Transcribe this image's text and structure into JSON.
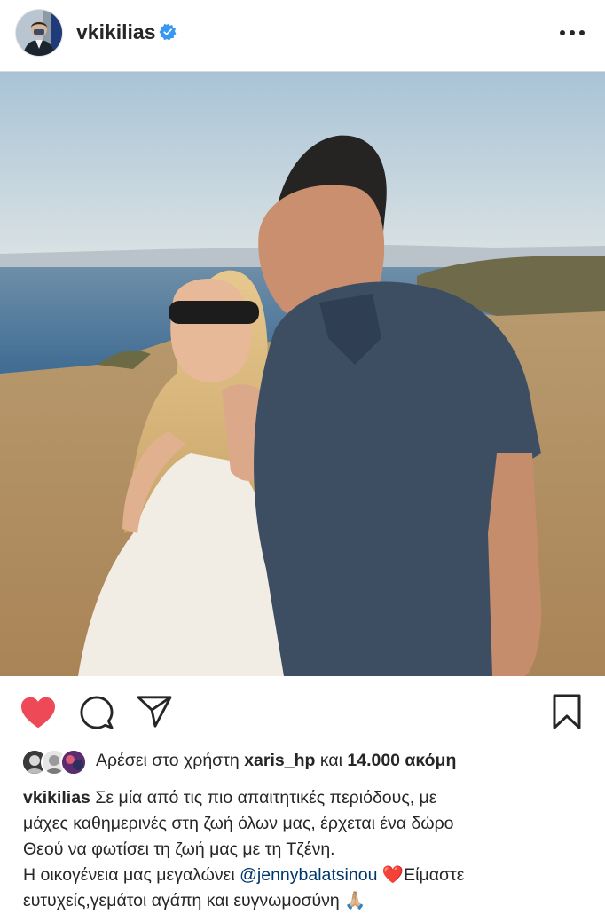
{
  "post": {
    "username": "vkikilias",
    "verified": true
  },
  "actions": {
    "liked": true,
    "like_color": "#ed4956",
    "icons": [
      "heart-icon",
      "comment-icon",
      "share-icon",
      "bookmark-icon"
    ]
  },
  "likes": {
    "prefix": "Αρέσει στο χρήστη",
    "user": "xaris_hp",
    "middle": "και",
    "count": "14.000 ακόμη"
  },
  "caption": {
    "username": "vkikilias",
    "line1": "Σε μία από τις πιο απαιτητικές περιόδους, με",
    "line2": "μάχες καθημερινές στη ζωή όλων μας, έρχεται ένα δώρο",
    "line3": "Θεού να φωτίσει τη ζωή μας με τη Τζένη.",
    "line4_prefix": "Η οικογένεια μας μεγαλώνει",
    "mention": "@jennybalatsinou",
    "line4_suffix": "Είμαστε",
    "line5": "ευτυχείς,γεμάτοι αγάπη και ευγνωμοσύνη",
    "emoji_heart": "❤️",
    "emoji_pray": "🙏🏼"
  }
}
